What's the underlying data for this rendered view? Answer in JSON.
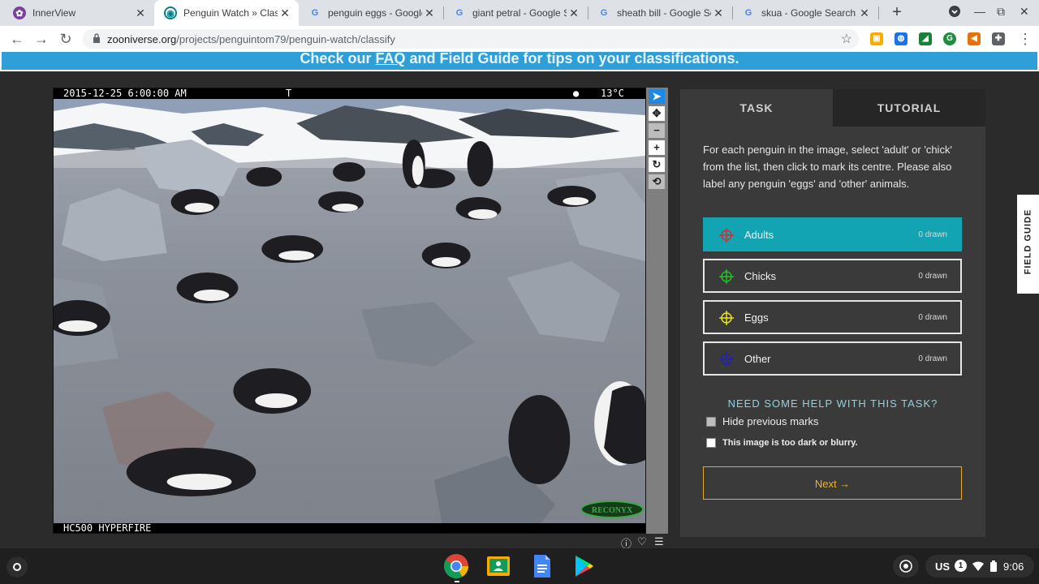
{
  "browser": {
    "tabs": [
      {
        "title": "InnerView",
        "favicon": "innerview-icon",
        "active": false
      },
      {
        "title": "Penguin Watch » Classify",
        "favicon": "zooniverse-icon",
        "active": true
      },
      {
        "title": "penguin eggs - Google Search",
        "favicon": "google-icon",
        "active": false
      },
      {
        "title": "giant petral - Google Search",
        "favicon": "google-icon",
        "active": false
      },
      {
        "title": "sheath bill - Google Search",
        "favicon": "google-icon",
        "active": false
      },
      {
        "title": "skua - Google Search",
        "favicon": "google-icon",
        "active": false
      }
    ],
    "url_domain": "zooniverse.org",
    "url_path": "/projects/penguintom79/penguin-watch/classify"
  },
  "banner": {
    "prefix": "Check our ",
    "faq": "FAQ",
    "suffix": " and Field Guide for tips on your classifications."
  },
  "subject": {
    "timestamp": "2015-12-25 6:00:00 AM",
    "mode": "T",
    "temperature": "13°C",
    "camera_model": "HC500 HYPERFIRE",
    "brand": "RECONYX"
  },
  "panel": {
    "tabs": {
      "task": "TASK",
      "tutorial": "TUTORIAL"
    },
    "instructions": "For each penguin in the image, select 'adult' or 'chick' from the list, then click to mark its centre. Please also label any penguin 'eggs' and 'other' animals.",
    "tools": [
      {
        "label": "Adults",
        "count": "0 drawn",
        "color": "#d32f2f",
        "active": true
      },
      {
        "label": "Chicks",
        "count": "0 drawn",
        "color": "#22c322",
        "active": false
      },
      {
        "label": "Eggs",
        "count": "0 drawn",
        "color": "#e8e81a",
        "active": false
      },
      {
        "label": "Other",
        "count": "0 drawn",
        "color": "#2222b0",
        "active": false
      }
    ],
    "help": "NEED SOME HELP WITH THIS TASK?",
    "hide_marks": "Hide previous marks",
    "too_dark": "This image is too dark or blurry.",
    "next": "Next →"
  },
  "field_guide": "FIELD GUIDE",
  "system": {
    "locale": "US",
    "notifications": "1",
    "time": "9:06"
  }
}
